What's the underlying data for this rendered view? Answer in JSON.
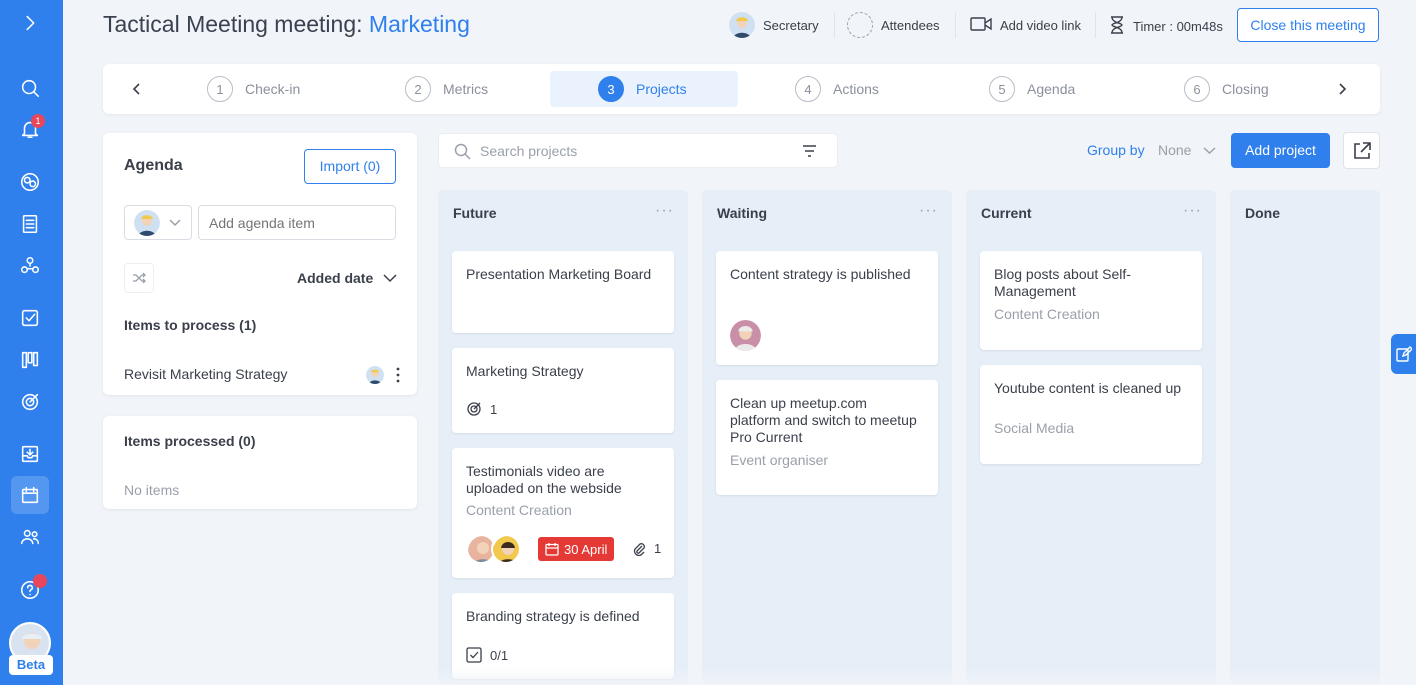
{
  "header": {
    "title_prefix": "Tactical Meeting meeting: ",
    "title_accent": "Marketing",
    "secretary": "Secretary",
    "attendees": "Attendees",
    "video_link": "Add video link",
    "timer": "Timer : 00m48s",
    "close_button": "Close this meeting"
  },
  "steps": [
    {
      "num": "1",
      "label": "Check-in"
    },
    {
      "num": "2",
      "label": "Metrics"
    },
    {
      "num": "3",
      "label": "Projects",
      "active": true
    },
    {
      "num": "4",
      "label": "Actions"
    },
    {
      "num": "5",
      "label": "Agenda"
    },
    {
      "num": "6",
      "label": "Closing"
    }
  ],
  "sidebar": {
    "notification_count": "1",
    "beta_label": "Beta"
  },
  "agenda": {
    "title": "Agenda",
    "import_button": "Import (0)",
    "input_placeholder": "Add agenda item",
    "sort_label": "Added date",
    "to_process_title": "Items to process (1)",
    "items": [
      "Revisit Marketing Strategy"
    ],
    "processed_title": "Items processed (0)",
    "no_items": "No items"
  },
  "toolbar": {
    "search_placeholder": "Search projects",
    "group_by_label": "Group by",
    "group_by_value": "None",
    "add_project": "Add project"
  },
  "columns": [
    {
      "title": "Future",
      "cards": [
        {
          "title": "Presentation Marketing Board"
        },
        {
          "title": "Marketing Strategy",
          "goal_count": "1"
        },
        {
          "title": "Testimonials video are uploaded on the webside",
          "subtitle": "Content Creation",
          "date": "30 April",
          "attachments": "1"
        },
        {
          "title": "Branding strategy is defined",
          "checklist": "0/1"
        }
      ]
    },
    {
      "title": "Waiting",
      "cards": [
        {
          "title": "Content strategy is published"
        },
        {
          "title": "Clean up meetup.com platform and switch to meetup Pro Current",
          "subtitle": "Event organiser"
        }
      ]
    },
    {
      "title": "Current",
      "cards": [
        {
          "title": "Blog posts about Self-Management",
          "subtitle": "Content Creation"
        },
        {
          "title": "Youtube content is cleaned up",
          "subtitle": "Social Media"
        }
      ]
    },
    {
      "title": "Done",
      "cards": []
    }
  ],
  "colors": {
    "accent": "#2f80ed",
    "sidebar": "#2f80ed",
    "column_bg": "#e6eef8",
    "date_badge": "#e53935",
    "notification": "#e8465b"
  }
}
